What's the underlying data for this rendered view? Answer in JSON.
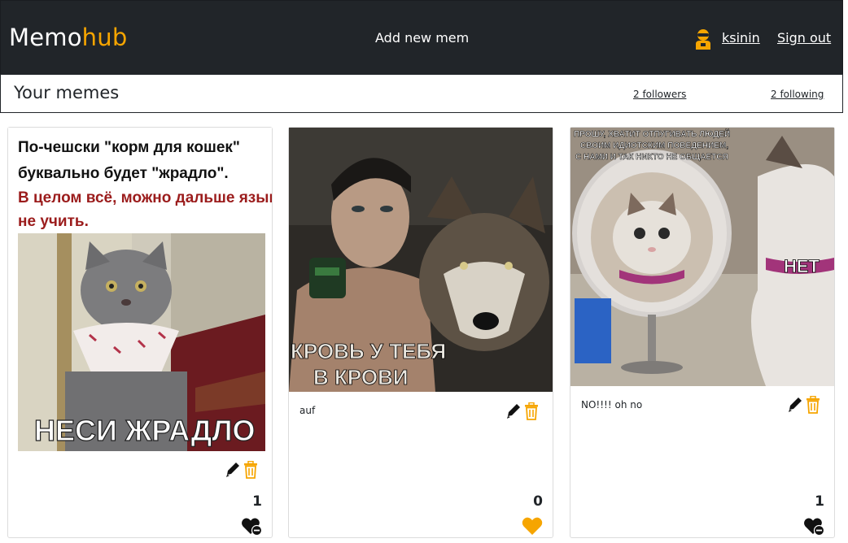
{
  "brand": {
    "part1": "Memo",
    "part2": "hub"
  },
  "nav": {
    "add_label": "Add new mem",
    "username": "ksinin",
    "signout_label": "Sign out"
  },
  "subheader": {
    "title": "Your memes",
    "followers": "2 followers",
    "following": "2 following"
  },
  "colors": {
    "accent": "#f6a500",
    "navbar": "#212529"
  },
  "memes": [
    {
      "image_text": {
        "line1": "По-чешски \"корм для кошек\"",
        "line2": "буквально будет \"жрадло\".",
        "line3": "В целом всё, можно дальше язык",
        "line4": "не учить.",
        "bottom": "НЕСИ ЖРАДЛО"
      },
      "caption": "",
      "likes": "1",
      "liked": true
    },
    {
      "image_text": {
        "line1": "КРОВЬ У ТЕБЯ",
        "line2": "В КРОВИ"
      },
      "caption": "auf",
      "likes": "0",
      "liked": false
    },
    {
      "image_text": {
        "line1": "ПРОШУ, ХВАТИТ ОТПУГИВАТЬ ЛЮДЕЙ",
        "line2": "СВОИМ ИДИОТСКИМ ПОВЕДЕНИЕМ,",
        "line3": "С НАМИ И ТАК НИКТО НЕ ОБЩАЕТСЯ",
        "side": "НЕТ"
      },
      "caption": "NO!!!! oh no",
      "likes": "1",
      "liked": true
    }
  ]
}
